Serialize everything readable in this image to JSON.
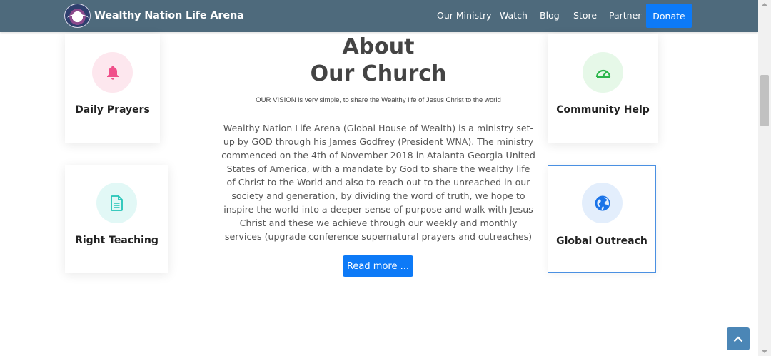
{
  "brand": {
    "name": "Wealthy Nation Life Arena"
  },
  "nav": {
    "items": [
      "Our Ministry",
      "Watch",
      "Blog",
      "Store",
      "Partner"
    ],
    "donate": "Donate"
  },
  "about": {
    "title_line1": "About",
    "title_line2": "Our Church",
    "vision": "OUR VISION is very simple, to share the Wealthy life of Jesus Christ to the world",
    "body": "Wealthy Nation Life Arena (Global House of Wealth) is a ministry set-up by GOD through his James Godfrey (President WNA). The ministry commenced on the 4th of November 2018 in Atalanta Georgia United States of America, with a mandate by God to share the wealthy life of Christ to the World and also to reach out to the unreached in our society and generation, by dividing the word of truth, we hope to inspire the world into a deeper sense of purpose and walk with Jesus Christ and these we achieve through our weekly and monthly services (upgrade conference supernatural prayers and outreaches)",
    "read_more": "Read more ..."
  },
  "features": [
    {
      "title": "Daily Prayers",
      "icon": "bell-icon",
      "color": "#f0508a",
      "bg": "#fde7ee"
    },
    {
      "title": "Right Teaching",
      "icon": "document-icon",
      "color": "#23c4b7",
      "bg": "#e2f8f6"
    },
    {
      "title": "Community Help",
      "icon": "speedometer-icon",
      "color": "#2bb64b",
      "bg": "#e6f8e8"
    },
    {
      "title": "Global Outreach",
      "icon": "globe-icon",
      "color": "#1a73e8",
      "bg": "#e3eefc"
    }
  ]
}
